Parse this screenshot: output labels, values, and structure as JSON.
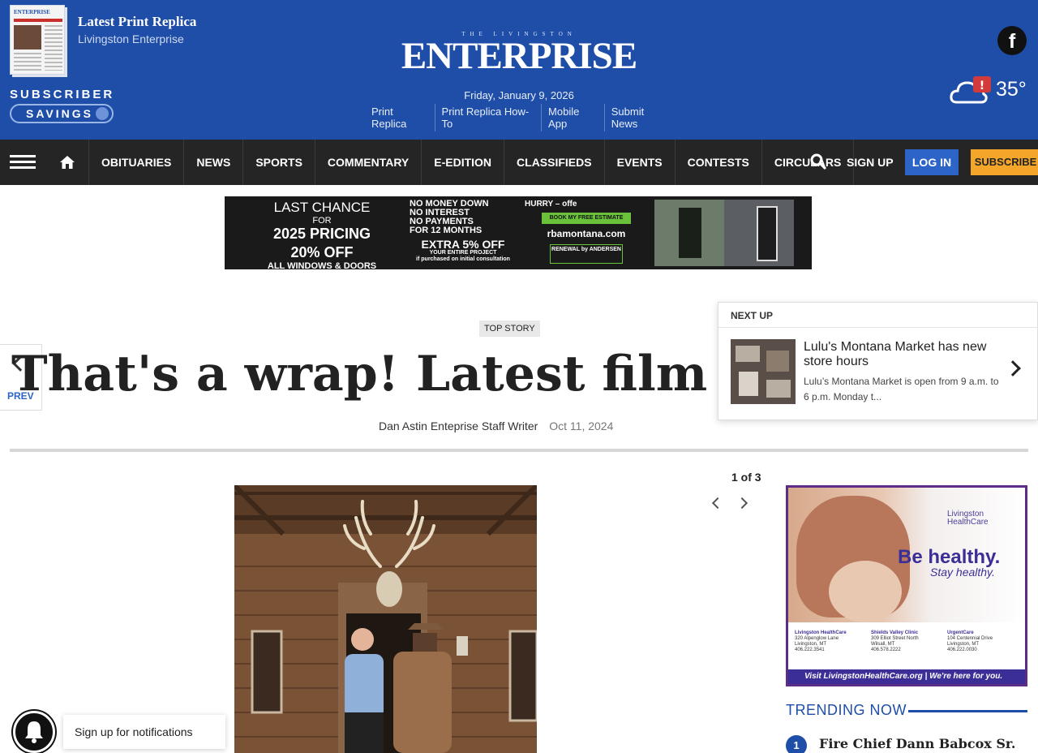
{
  "header": {
    "replica_title": "Latest Print Replica",
    "replica_subtitle": "Livingston Enterprise",
    "replica_thumb_text": "ENTERPRISE",
    "savings_line1": "SUBSCRIBER",
    "savings_line2": "SAVINGS",
    "logo_small": "THE LIVINGSTON",
    "logo": "ENTERPRISE",
    "date": "Friday, January 9, 2026",
    "links": [
      "Print Replica",
      "Print Replica How-To",
      "Mobile App",
      "Submit News"
    ],
    "facebook_glyph": "f",
    "temperature": "35°",
    "brand_color": "#1f4ea8"
  },
  "nav": {
    "items": [
      "OBITUARIES",
      "NEWS",
      "SPORTS",
      "COMMENTARY",
      "E-EDITION",
      "CLASSIFIEDS",
      "EVENTS",
      "CONTESTS",
      "CIRCULARS"
    ],
    "signup": "SIGN UP",
    "login": "LOG IN",
    "subscribe": "SUBSCRIBE"
  },
  "banner_ad": {
    "line1": "LAST CHANCE",
    "line2": "FOR",
    "line3": "2025 PRICING",
    "line4": "20% OFF",
    "line5": "ALL WINDOWS & DOORS",
    "offer1": "NO MONEY DOWN",
    "offer2": "NO INTEREST",
    "offer3": "NO PAYMENTS",
    "offer4": "FOR 12 MONTHS",
    "offer5": "EXTRA 5% OFF",
    "offer6": "YOUR ENTIRE PROJECT",
    "offer7": "if purchased on initial consultation",
    "hurry": "HURRY – offe",
    "cta": "BOOK MY FREE ESTIMATE",
    "url": "rbamontana.com",
    "renewal": "RENEWAL by ANDERSEN"
  },
  "article": {
    "prev_label": "PREV",
    "tag": "TOP STORY",
    "headline": "That's a wrap! Latest film conclu",
    "author": "Dan Astin Enteprise Staff Writer",
    "date": "Oct 11, 2024"
  },
  "next_up": {
    "label": "NEXT UP",
    "title": "Lulu's Montana Market has new store hours",
    "description": "Lulu’s Montana Market is open from 9 a.m. to 6 p.m. Monday t..."
  },
  "gallery": {
    "counter": "1 of 3"
  },
  "side_ad": {
    "brand1": "Livingston",
    "brand2": "HealthCare",
    "headline": "Be healthy.",
    "subhead": "Stay healthy.",
    "locations": [
      {
        "name": "Livingston HealthCare",
        "addr1": "320 Alpenglow Lane",
        "addr2": "Livingston, MT",
        "phone": "406.222.3541"
      },
      {
        "name": "Shields Valley Clinic",
        "addr1": "309 Elliot Street North",
        "addr2": "Wilsall, MT",
        "phone": "406.578.2222"
      },
      {
        "name": "UrgentCare",
        "addr1": "104 Centennial Drive",
        "addr2": "Livingston, MT",
        "phone": "406.222.0030"
      }
    ],
    "footer": "Visit LivingstonHealthCare.org  |  We're here for you."
  },
  "trending": {
    "title": "TRENDING NOW",
    "items": [
      {
        "rank": "1",
        "text": "Fire Chief Dann Babcox Sr."
      }
    ]
  },
  "notifications": {
    "label": "Sign up for notifications"
  }
}
